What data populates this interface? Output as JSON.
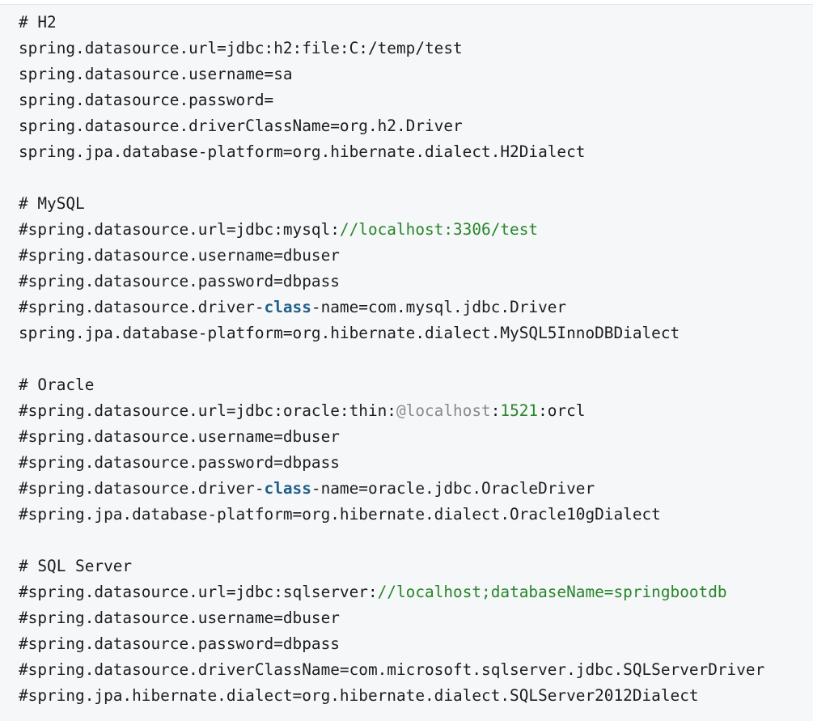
{
  "code_view": {
    "lines": [
      [
        {
          "t": "# H2"
        }
      ],
      [
        {
          "t": "spring.datasource.url=jdbc:h2:file:C:/temp/test"
        }
      ],
      [
        {
          "t": "spring.datasource.username=sa"
        }
      ],
      [
        {
          "t": "spring.datasource.password="
        }
      ],
      [
        {
          "t": "spring.datasource.driverClassName=org.h2.Driver"
        }
      ],
      [
        {
          "t": "spring.jpa.database-platform=org.hibernate.dialect.H2Dialect"
        }
      ],
      [],
      [
        {
          "t": "# MySQL"
        }
      ],
      [
        {
          "t": "#spring.datasource.url=jdbc:mysql:"
        },
        {
          "t": "//localhost:3306/test",
          "k": "str"
        }
      ],
      [
        {
          "t": "#spring.datasource.username=dbuser"
        }
      ],
      [
        {
          "t": "#spring.datasource.password=dbpass"
        }
      ],
      [
        {
          "t": "#spring.datasource.driver-"
        },
        {
          "t": "class",
          "k": "kw"
        },
        {
          "t": "-name=com.mysql.jdbc.Driver"
        }
      ],
      [
        {
          "t": "spring.jpa.database-platform=org.hibernate.dialect.MySQL5InnoDBDialect"
        }
      ],
      [],
      [
        {
          "t": "# Oracle"
        }
      ],
      [
        {
          "t": "#spring.datasource.url=jdbc:oracle:thin:"
        },
        {
          "t": "@localhost",
          "k": "at"
        },
        {
          "t": ":"
        },
        {
          "t": "1521",
          "k": "str"
        },
        {
          "t": ":orcl"
        }
      ],
      [
        {
          "t": "#spring.datasource.username=dbuser"
        }
      ],
      [
        {
          "t": "#spring.datasource.password=dbpass"
        }
      ],
      [
        {
          "t": "#spring.datasource.driver-"
        },
        {
          "t": "class",
          "k": "kw"
        },
        {
          "t": "-name=oracle.jdbc.OracleDriver"
        }
      ],
      [
        {
          "t": "#spring.jpa.database-platform=org.hibernate.dialect.Oracle10gDialect"
        }
      ],
      [],
      [
        {
          "t": "# SQL Server"
        }
      ],
      [
        {
          "t": "#spring.datasource.url=jdbc:sqlserver:"
        },
        {
          "t": "//localhost;databaseName=springbootdb",
          "k": "str"
        }
      ],
      [
        {
          "t": "#spring.datasource.username=dbuser"
        }
      ],
      [
        {
          "t": "#spring.datasource.password=dbpass"
        }
      ],
      [
        {
          "t": "#spring.datasource.driverClassName=com.microsoft.sqlserver.jdbc.SQLServerDriver"
        }
      ],
      [
        {
          "t": "#spring.jpa.hibernate.dialect=org.hibernate.dialect.SQLServer2012Dialect"
        }
      ]
    ],
    "colors": {
      "background": "#f6f7f8",
      "text": "#1d1d1d",
      "keyword": "#1f5f8b",
      "string": "#26862a",
      "annotation": "#8a8a8a"
    }
  }
}
